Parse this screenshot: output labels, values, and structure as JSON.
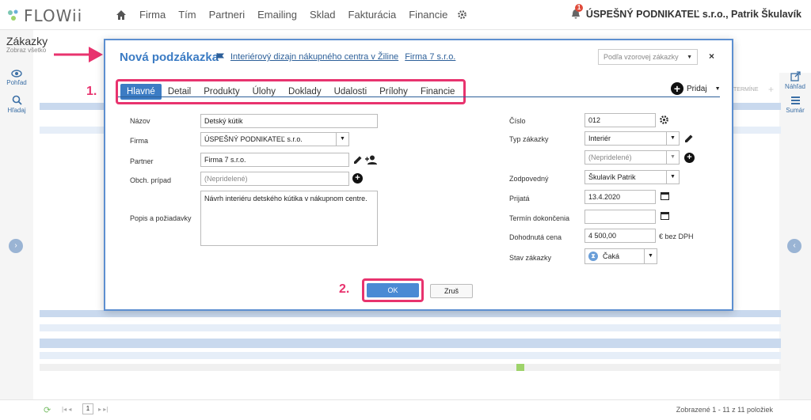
{
  "app": {
    "logo": "FLOWii",
    "nav": [
      "Firma",
      "Tím",
      "Partneri",
      "Emailing",
      "Sklad",
      "Fakturácia",
      "Financie"
    ],
    "user": "ÚSPEŠNÝ PODNIKATEĽ s.r.o., Patrik Škulavík",
    "notif_count": "1"
  },
  "page": {
    "title": "Zákazky",
    "subtitle": "Zobraz všetko",
    "left": {
      "view": "Pohľad",
      "search": "Hľadaj"
    },
    "right": {
      "preview": "Náhľad",
      "summary": "Sumár"
    },
    "bg_col": "TERMÍNE",
    "footer": "Zobrazené 1 - 11 z 11 položiek",
    "pager_page": "1"
  },
  "annotations": {
    "one": "1.",
    "two": "2."
  },
  "modal": {
    "title": "Nová podzákazka",
    "link_project": "Interiérový dizajn nákupného centra v Žiline",
    "link_company": "Firma 7 s.r.o.",
    "template_ph": "Podľa vzorovej zákazky",
    "tabs": [
      "Hlavné",
      "Detail",
      "Produkty",
      "Úlohy",
      "Doklady",
      "Udalosti",
      "Prílohy",
      "Financie"
    ],
    "add_label": "Pridaj",
    "labels": {
      "nazov": "Názov",
      "firma": "Firma",
      "partner": "Partner",
      "obch": "Obch. prípad",
      "popis": "Popis a požiadavky",
      "cislo": "Číslo",
      "typ": "Typ zákazky",
      "zodp": "Zodpovedný",
      "prijata": "Prijatá",
      "termin": "Termín dokončenia",
      "cena": "Dohodnutá cena",
      "stav": "Stav zákazky"
    },
    "values": {
      "nazov": "Detský kútik",
      "firma": "ÚSPEŠNÝ PODNIKATEĽ s.r.o.",
      "partner": "Firma 7 s.r.o.",
      "obch_ph": "(Nepridelené)",
      "popis": "Návrh interiéru detského kútika v nákupnom centre.",
      "cislo": "012",
      "typ": "Interiér",
      "typ2_ph": "(Nepridelené)",
      "zodp": "Škulavík Patrik",
      "prijata": "13.4.2020",
      "termin": "",
      "cena": "4 500,00",
      "cena_unit": "€ bez DPH",
      "stav": "Čaká"
    },
    "ok": "OK",
    "cancel": "Zruš"
  }
}
